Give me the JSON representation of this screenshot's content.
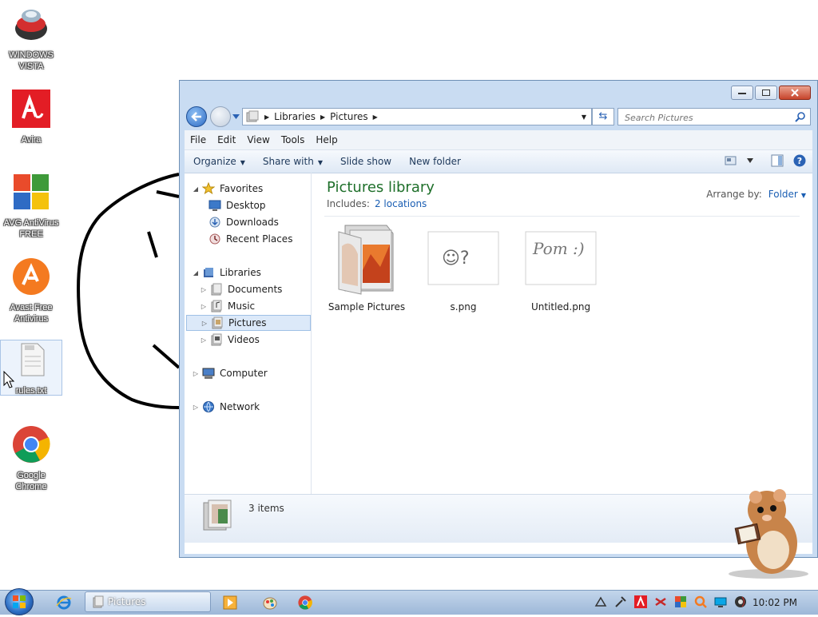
{
  "desktop": {
    "icons": [
      {
        "label": "WINDOWS VISTA",
        "icon": "windows-vista-icon"
      },
      {
        "label": "Avira",
        "icon": "avira-icon"
      },
      {
        "label": "AVG AntiVirus FREE",
        "icon": "avg-icon"
      },
      {
        "label": "Avast Free Antivirus",
        "icon": "avast-icon"
      },
      {
        "label": "rules.txt",
        "icon": "text-file-icon"
      },
      {
        "label": "Google Chrome",
        "icon": "chrome-icon"
      }
    ]
  },
  "window": {
    "address": {
      "crumbs": [
        "Libraries",
        "Pictures"
      ]
    },
    "search": {
      "placeholder": "Search Pictures"
    },
    "menu": [
      "File",
      "Edit",
      "View",
      "Tools",
      "Help"
    ],
    "commands": {
      "organize": "Organize",
      "share_with": "Share with",
      "slide_show": "Slide show",
      "new_folder": "New folder"
    },
    "nav": {
      "favorites": "Favorites",
      "desktop": "Desktop",
      "downloads": "Downloads",
      "recent_places": "Recent Places",
      "libraries": "Libraries",
      "documents": "Documents",
      "music": "Music",
      "pictures": "Pictures",
      "videos": "Videos",
      "computer": "Computer",
      "network": "Network"
    },
    "library": {
      "title": "Pictures library",
      "includes_label": "Includes:",
      "includes_link": "2 locations",
      "arrange_label": "Arrange by:",
      "arrange_value": "Folder"
    },
    "files": [
      {
        "name": "Sample Pictures",
        "type": "folder"
      },
      {
        "name": "s.png",
        "type": "image",
        "sketch_text": "☺?"
      },
      {
        "name": "Untitled.png",
        "type": "image",
        "sketch_text": "Pom :)"
      }
    ],
    "status": {
      "count": "3 items"
    }
  },
  "taskbar": {
    "active_task": "Pictures",
    "clock": "10:02 PM"
  }
}
